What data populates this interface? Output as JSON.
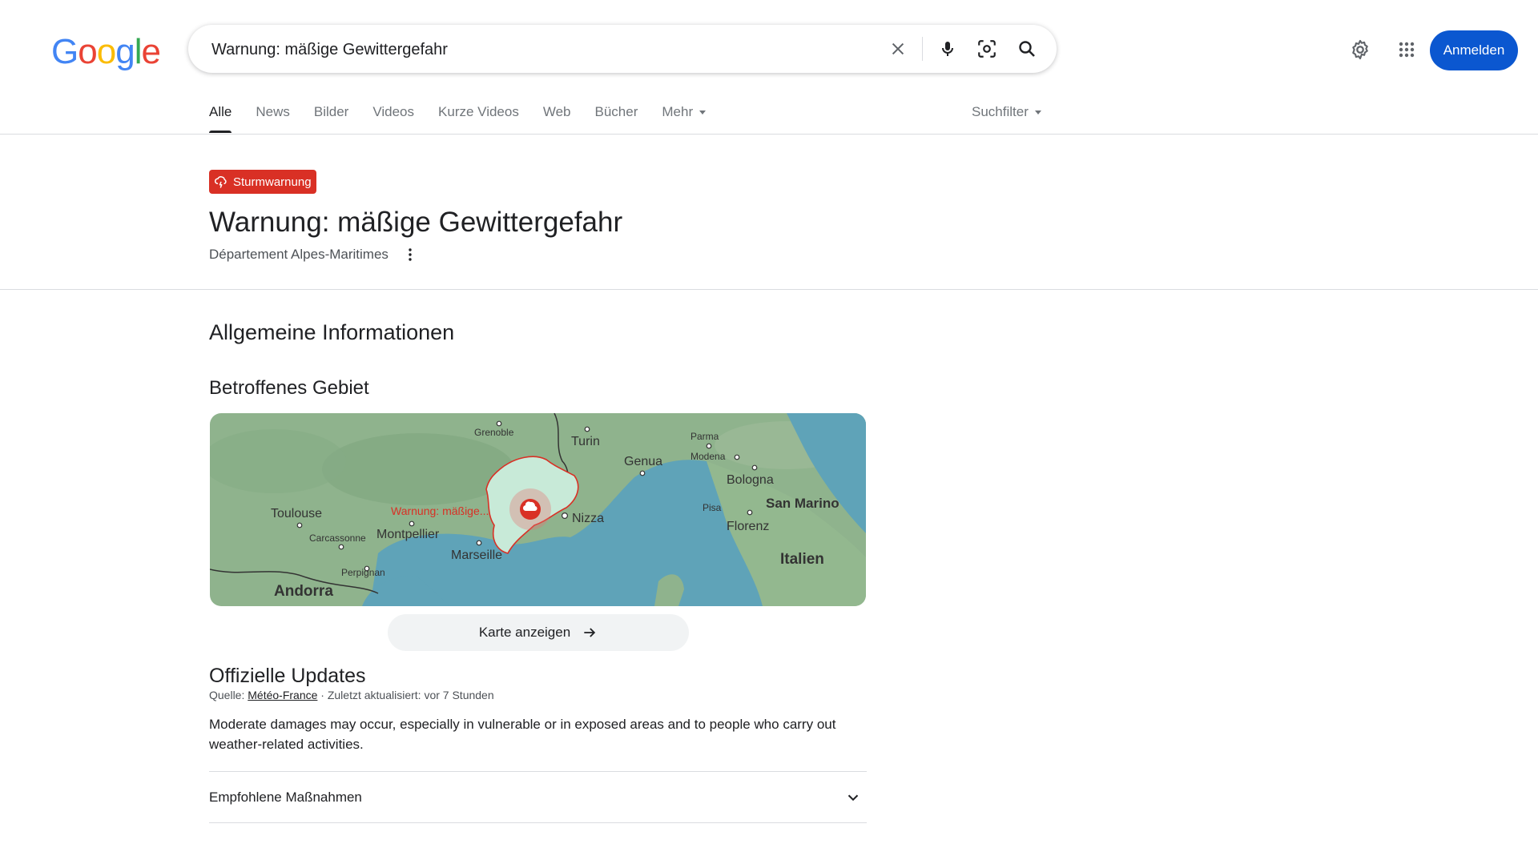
{
  "header": {
    "logo": "Google",
    "search": {
      "value": "Warnung: mäßige Gewittergefahr"
    },
    "icons": [
      "close-icon",
      "microphone-icon",
      "lens-icon",
      "search-icon",
      "gear-icon",
      "apps-grid-icon"
    ],
    "signin_label": "Anmelden"
  },
  "tabs": [
    {
      "label": "Alle",
      "active": true
    },
    {
      "label": "News"
    },
    {
      "label": "Bilder"
    },
    {
      "label": "Videos"
    },
    {
      "label": "Kurze Videos"
    },
    {
      "label": "Web"
    },
    {
      "label": "Bücher"
    },
    {
      "label": "Mehr"
    }
  ],
  "tools_label": "Suchfilter",
  "alert": {
    "badge": "Sturmwarnung",
    "title": "Warnung: mäßige Gewittergefahr",
    "region": "Département Alpes-Maritimes"
  },
  "general_heading": "Allgemeine Informationen",
  "area_heading": "Betroffenes Gebiet",
  "map": {
    "labels": {
      "grenoble": "Grenoble",
      "turin": "Turin",
      "parma": "Parma",
      "modena": "Modena",
      "genua": "Genua",
      "bologna": "Bologna",
      "toulouse": "Toulouse",
      "warning": "Warnung: mäßige...",
      "nizza": "Nizza",
      "pisa": "Pisa",
      "san_marino": "San Marino",
      "carcassonne": "Carcassonne",
      "montpellier": "Montpellier",
      "florenz": "Florenz",
      "marseille": "Marseille",
      "italien": "Italien",
      "perpignan": "Perpignan",
      "andorra": "Andorra"
    }
  },
  "map_button": "Karte anzeigen",
  "updates": {
    "heading": "Offizielle Updates",
    "source_prefix": "Quelle: ",
    "source_link": "Météo-France",
    "source_suffix": " · Zuletzt aktualisiert: vor 7 Stunden",
    "text": "Moderate damages may occur, especially in vulnerable or in exposed areas and to people who carry out weather-related activities."
  },
  "measures_label": "Empfohlene Maßnahmen",
  "colors": {
    "alert_red": "#d93025",
    "signin_blue": "#0b57d0",
    "sea": "#5fa3b8",
    "land": "#8fb38d"
  }
}
